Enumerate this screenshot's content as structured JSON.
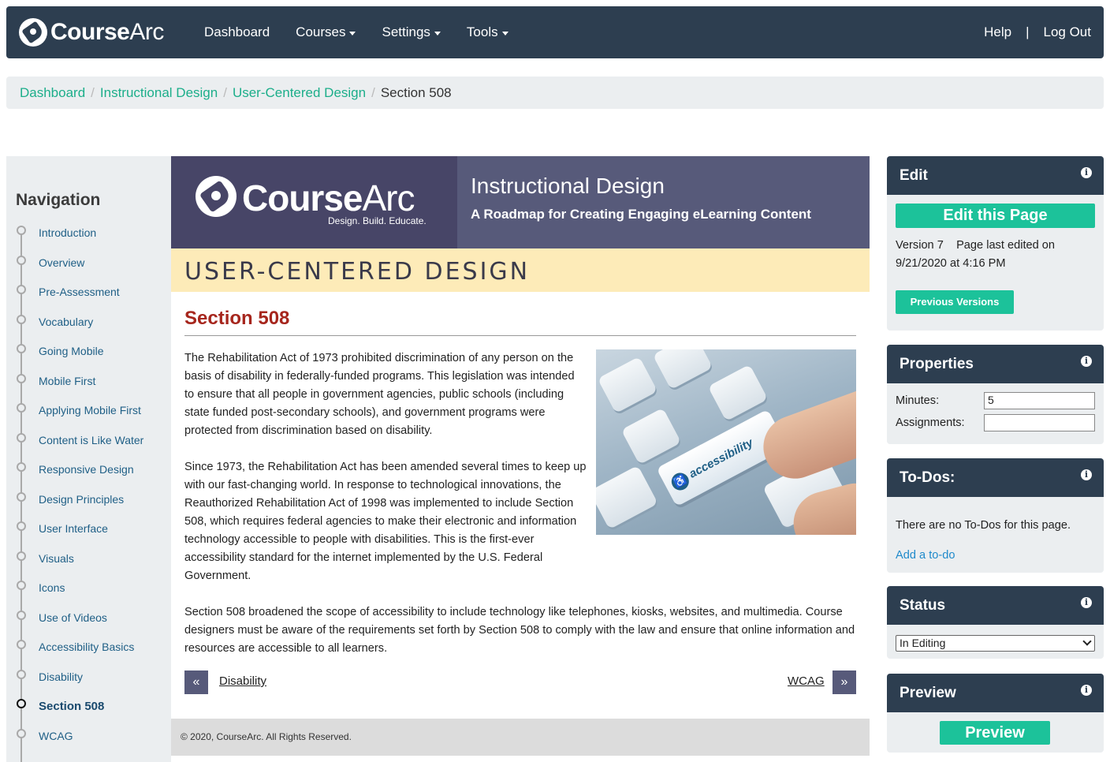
{
  "topbar": {
    "brand_main": "Course",
    "brand_arc": "Arc",
    "nav": [
      {
        "label": "Dashboard",
        "dropdown": false
      },
      {
        "label": "Courses",
        "dropdown": true
      },
      {
        "label": "Settings",
        "dropdown": true
      },
      {
        "label": "Tools",
        "dropdown": true
      }
    ],
    "help": "Help",
    "separator": "|",
    "logout": "Log Out"
  },
  "breadcrumb": {
    "items": [
      "Dashboard",
      "Instructional Design",
      "User-Centered Design"
    ],
    "current": "Section 508",
    "separator": "/"
  },
  "navigation": {
    "title": "Navigation",
    "items": [
      "Introduction",
      "Overview",
      "Pre-Assessment",
      "Vocabulary",
      "Going Mobile",
      "Mobile First",
      "Applying Mobile First",
      "Content is Like Water",
      "Responsive Design",
      "Design Principles",
      "User Interface",
      "Visuals",
      "Icons",
      "Use of Videos",
      "Accessibility Basics",
      "Disability",
      "Section 508",
      "WCAG"
    ],
    "active": "Section 508"
  },
  "banner": {
    "brand_main": "Course",
    "brand_arc": "Arc",
    "tagline": "Design. Build. Educate.",
    "course_title": "Instructional Design",
    "course_subtitle": "A Roadmap for Creating Engaging eLearning Content"
  },
  "lesson": {
    "title": "USER-CENTERED DESIGN"
  },
  "content": {
    "section_title": "Section 508",
    "image_key_label": "accessibility",
    "paragraphs": [
      "The Rehabilitation Act of 1973 prohibited discrimination of any person on the basis of disability in federally-funded programs. This legislation was intended to ensure that all people in government agencies, public schools (including state funded post-secondary schools), and government programs were protected from discrimination based on disability.",
      "Since 1973, the Rehabilitation Act has been amended several times to keep up with our fast-changing world. In response to technological innovations, the Reauthorized Rehabilitation Act of 1998 was implemented to include Section 508, which requires federal agencies to make their electronic and information technology accessible to people with disabilities. This is the first-ever accessibility standard for the internet implemented by the U.S. Federal Government.",
      "Section 508 broadened the scope of accessibility to include technology like telephones, kiosks, websites, and multimedia. Course designers must be aware of the requirements set forth by Section 508 to comply with the law and ensure that online information and resources are accessible to all learners."
    ],
    "prev_symbol": "«",
    "prev_label": "Disability",
    "next_symbol": "»",
    "next_label": "WCAG"
  },
  "footer": {
    "copyright": "© 2020, CourseArc. All Rights Reserved."
  },
  "sidebar": {
    "info_symbol": "i",
    "edit": {
      "title": "Edit",
      "button": "Edit this Page",
      "version_line": "Version 7    Page last edited on",
      "date_line": "9/21/2020 at 4:16 PM",
      "previous_versions": "Previous Versions"
    },
    "properties": {
      "title": "Properties",
      "minutes_label": "Minutes:",
      "minutes_value": "5",
      "assignments_label": "Assignments:",
      "assignments_value": ""
    },
    "todos": {
      "title": "To-Dos:",
      "empty_text": "There are no To-Dos for this page.",
      "add_link": "Add a to-do"
    },
    "status": {
      "title": "Status",
      "selected": "In Editing"
    },
    "preview": {
      "title": "Preview",
      "button": "Preview"
    }
  },
  "colors": {
    "topbar": "#2d3e50",
    "accent_green": "#1cc29a",
    "link_green": "#1cae8a",
    "section_red": "#a6261d",
    "lesson_bar": "#fdebb8",
    "banner_purple": "#575a7a"
  }
}
